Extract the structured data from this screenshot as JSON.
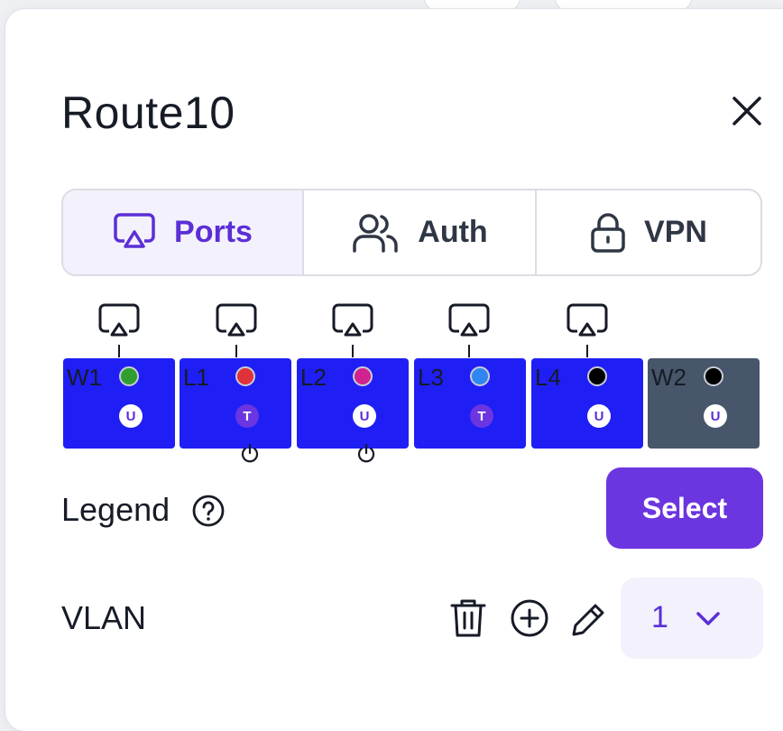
{
  "panel": {
    "title": "Route10"
  },
  "tabs": [
    {
      "label": "Ports",
      "icon": "ports-icon",
      "active": true
    },
    {
      "label": "Auth",
      "icon": "users-icon",
      "active": false
    },
    {
      "label": "VPN",
      "icon": "lock-icon",
      "active": false
    }
  ],
  "ports": [
    {
      "label": "W1",
      "dot_color": "#2f9e2f",
      "badge": "U",
      "uplink_icon": true,
      "power_icon": false
    },
    {
      "label": "L1",
      "dot_color": "#e0323a",
      "badge": "T",
      "uplink_icon": true,
      "power_icon": true
    },
    {
      "label": "L2",
      "dot_color": "#d0238f",
      "badge": "U",
      "uplink_icon": true,
      "power_icon": true
    },
    {
      "label": "L3",
      "dot_color": "#2f86f0",
      "badge": "T",
      "uplink_icon": true,
      "power_icon": false
    },
    {
      "label": "L4",
      "dot_color": "#000000",
      "badge": "U",
      "uplink_icon": true,
      "power_icon": false
    },
    {
      "label": "W2",
      "dot_color": "#000000",
      "badge": "U",
      "uplink_icon": false,
      "power_icon": false
    }
  ],
  "legend": {
    "label": "Legend",
    "select_label": "Select"
  },
  "vlan": {
    "label": "VLAN",
    "value": "1"
  },
  "colors": {
    "accent": "#6b35e0",
    "active_tab_text": "#5b2fd6",
    "port_active": "#1f1ff5",
    "port_wan2": "#47566a"
  }
}
